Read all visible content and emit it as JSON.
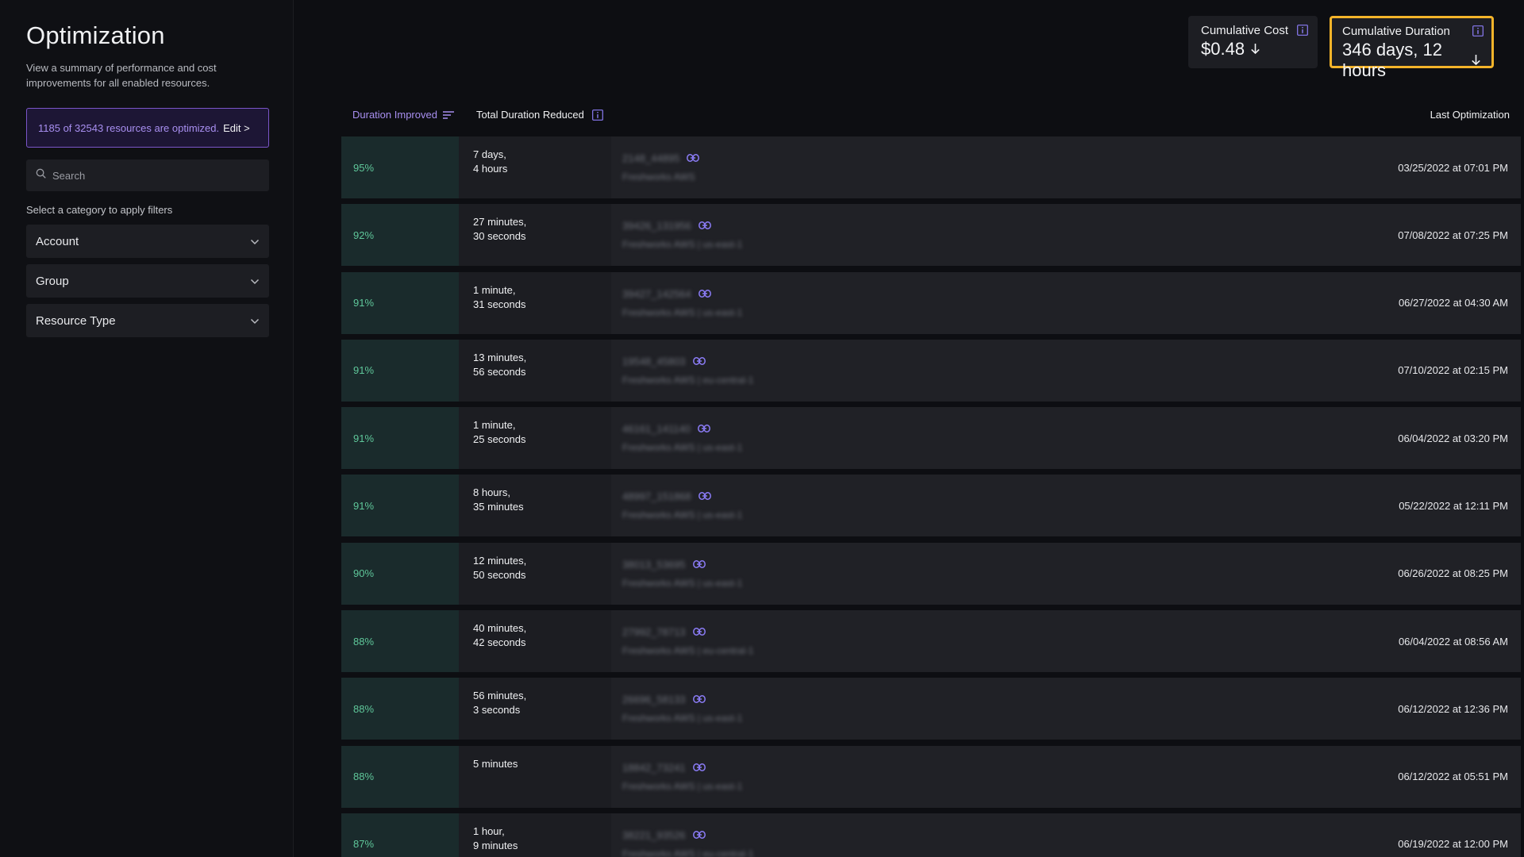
{
  "sidebar": {
    "title": "Optimization",
    "description": "View a summary of performance and cost improvements for all enabled resources.",
    "banner": {
      "count_text": "1185 of 32543 resources are optimized.",
      "edit_label": "Edit >"
    },
    "search_placeholder": "Search",
    "filter_label": "Select a category to apply filters",
    "filters": [
      "Account",
      "Group",
      "Resource Type"
    ]
  },
  "kpis": {
    "cost": {
      "label": "Cumulative Cost",
      "value": "$0.48"
    },
    "duration": {
      "label": "Cumulative Duration",
      "value": "346 days, 12 hours"
    }
  },
  "table": {
    "headers": {
      "duration_improved": "Duration Improved",
      "total_reduced": "Total Duration Reduced",
      "last_optimization": "Last Optimization"
    },
    "rows": [
      {
        "pct": "95%",
        "reduced_1": "7 days,",
        "reduced_2": "4 hours",
        "resource_id": "2148_44895",
        "resource_sub": "Freshworks AWS",
        "date": "03/25/2022 at 07:01 PM"
      },
      {
        "pct": "92%",
        "reduced_1": "27 minutes,",
        "reduced_2": "30 seconds",
        "resource_id": "39426_131956",
        "resource_sub": "Freshworks AWS | us-east-1",
        "date": "07/08/2022 at 07:25 PM"
      },
      {
        "pct": "91%",
        "reduced_1": "1 minute,",
        "reduced_2": "31 seconds",
        "resource_id": "39427_142564",
        "resource_sub": "Freshworks AWS | us-east-1",
        "date": "06/27/2022 at 04:30 AM"
      },
      {
        "pct": "91%",
        "reduced_1": "13 minutes,",
        "reduced_2": "56 seconds",
        "resource_id": "19548_45803",
        "resource_sub": "Freshworks AWS | eu-central-1",
        "date": "07/10/2022 at 02:15 PM"
      },
      {
        "pct": "91%",
        "reduced_1": "1 minute,",
        "reduced_2": "25 seconds",
        "resource_id": "46161_141140",
        "resource_sub": "Freshworks AWS | us-east-1",
        "date": "06/04/2022 at 03:20 PM"
      },
      {
        "pct": "91%",
        "reduced_1": "8 hours,",
        "reduced_2": "35 minutes",
        "resource_id": "48997_151868",
        "resource_sub": "Freshworks AWS | us-east-1",
        "date": "05/22/2022 at 12:11 PM"
      },
      {
        "pct": "90%",
        "reduced_1": "12 minutes,",
        "reduced_2": "50 seconds",
        "resource_id": "38013_53695",
        "resource_sub": "Freshworks AWS | us-east-1",
        "date": "06/26/2022 at 08:25 PM"
      },
      {
        "pct": "88%",
        "reduced_1": "40 minutes,",
        "reduced_2": "42 seconds",
        "resource_id": "27992_78713",
        "resource_sub": "Freshworks AWS | eu-central-1",
        "date": "06/04/2022 at 08:56 AM"
      },
      {
        "pct": "88%",
        "reduced_1": "56 minutes,",
        "reduced_2": "3 seconds",
        "resource_id": "26696_58133",
        "resource_sub": "Freshworks AWS | us-east-1",
        "date": "06/12/2022 at 12:36 PM"
      },
      {
        "pct": "88%",
        "reduced_1": "5 minutes",
        "reduced_2": "",
        "resource_id": "18842_73241",
        "resource_sub": "Freshworks AWS | us-east-1",
        "date": "06/12/2022 at 05:51 PM"
      },
      {
        "pct": "87%",
        "reduced_1": "1 hour,",
        "reduced_2": "9 minutes",
        "resource_id": "38221_93526",
        "resource_sub": "Freshworks AWS | eu-central-1",
        "date": "06/19/2022 at 12:00 PM"
      }
    ]
  },
  "colors": {
    "accent": "#a88ff0",
    "positive": "#5fc79a",
    "highlight": "#f4b42a",
    "link": "#8b7cf6"
  },
  "icons": {
    "search": "search-icon",
    "chevron": "chevron-down-icon",
    "info": "info-icon",
    "arrow": "arrow-down-icon",
    "sort": "sort-icon",
    "link": "link-icon"
  }
}
